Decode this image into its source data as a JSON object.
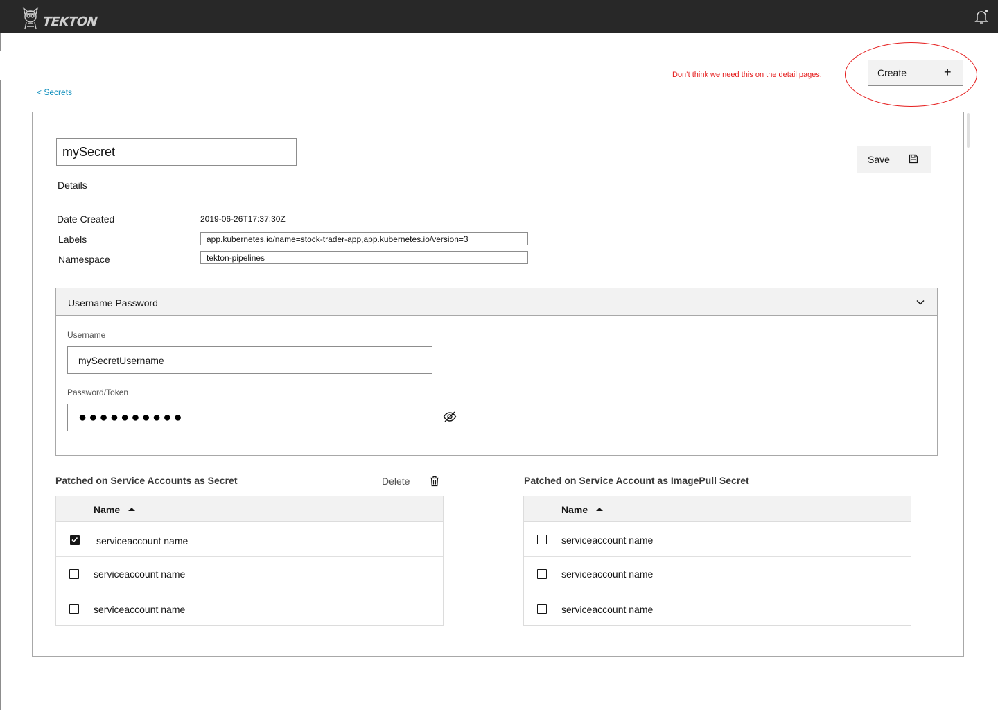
{
  "header": {
    "brand": "TEKTON",
    "logo_icon": "tekton-cat-logo-icon",
    "notification_icon": "bell-icon"
  },
  "breadcrumb": {
    "label": "< Secrets"
  },
  "annotation": {
    "note": "Don’t think we need this on the detail pages.",
    "color": "#e51c1c"
  },
  "actions": {
    "create_label": "Create",
    "create_icon": "+",
    "save_label": "Save",
    "save_icon": "floppy-disk-icon"
  },
  "secret": {
    "name": "mySecret",
    "details_tab": "Details",
    "date_created_label": "Date Created",
    "date_created_value": "2019-06-26T17:37:30Z",
    "labels_label": "Labels",
    "labels_value": "app.kubernetes.io/name=stock-trader-app,app.kubernetes.io/version=3",
    "namespace_label": "Namespace",
    "namespace_value": "tekton-pipelines"
  },
  "credentials": {
    "section_title": "Username Password",
    "expanded": true,
    "username_label": "Username",
    "username_value": "mySecretUsername",
    "password_label": "Password/Token",
    "password_masked": "●●●●●●●●●●",
    "show_password_icon": "eye-icon"
  },
  "secret_table": {
    "title": "Patched on Service Accounts as Secret",
    "delete_label": "Delete",
    "delete_icon": "trash-icon",
    "column_name": "Name",
    "sort": "ascending",
    "rows": [
      {
        "name": "serviceaccount name",
        "checked": true
      },
      {
        "name": "serviceaccount name",
        "checked": false
      },
      {
        "name": "serviceaccount name",
        "checked": false
      }
    ]
  },
  "imagepull_table": {
    "title": "Patched on Service Account as ImagePull Secret",
    "column_name": "Name",
    "sort": "ascending",
    "rows": [
      {
        "name": "serviceaccount name",
        "checked": false
      },
      {
        "name": "serviceaccount name",
        "checked": false
      },
      {
        "name": "serviceaccount name",
        "checked": false
      }
    ]
  }
}
